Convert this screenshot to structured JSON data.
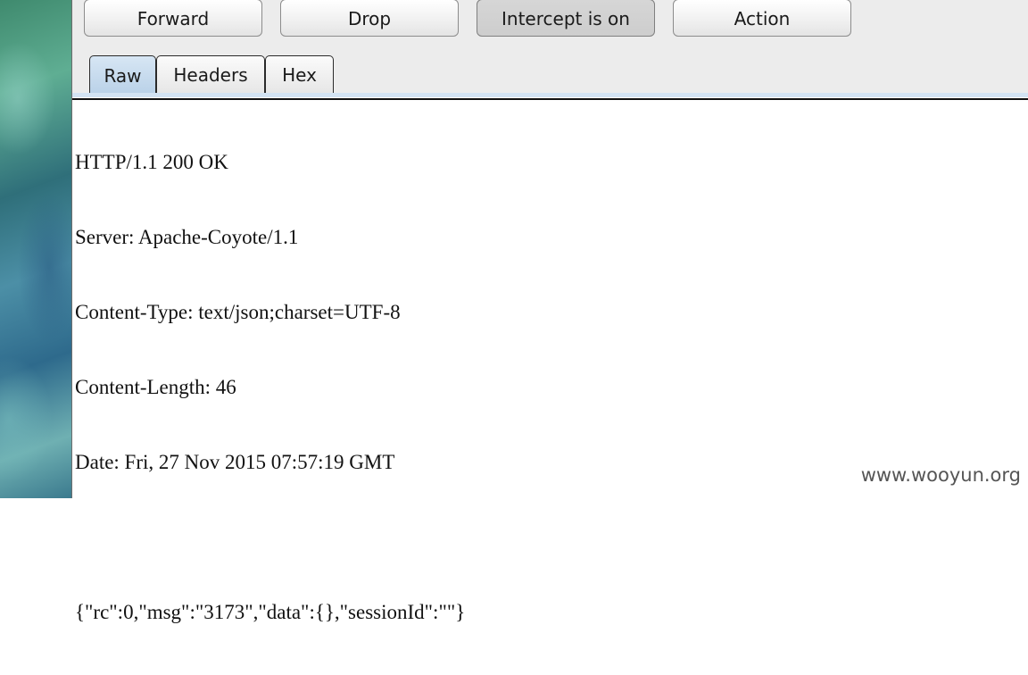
{
  "toolbar": {
    "forward_label": "Forward",
    "drop_label": "Drop",
    "intercept_label": "Intercept is on",
    "action_label": "Action"
  },
  "tabs": [
    {
      "label": "Raw",
      "active": true
    },
    {
      "label": "Headers",
      "active": false
    },
    {
      "label": "Hex",
      "active": false
    }
  ],
  "response": {
    "lines": [
      "HTTP/1.1 200 OK",
      "Server: Apache-Coyote/1.1",
      "Content-Type: text/json;charset=UTF-8",
      "Content-Length: 46",
      "Date: Fri, 27 Nov 2015 07:57:19 GMT",
      "",
      "{\"rc\":0,\"msg\":\"3173\",\"data\":{},\"sessionId\":\"\"}"
    ]
  },
  "watermark": "www.wooyun.org",
  "colors": {
    "active_tab": "#c6dbee",
    "toolbar_bg": "#ececec",
    "pressed_button": "#d0d0d0"
  }
}
